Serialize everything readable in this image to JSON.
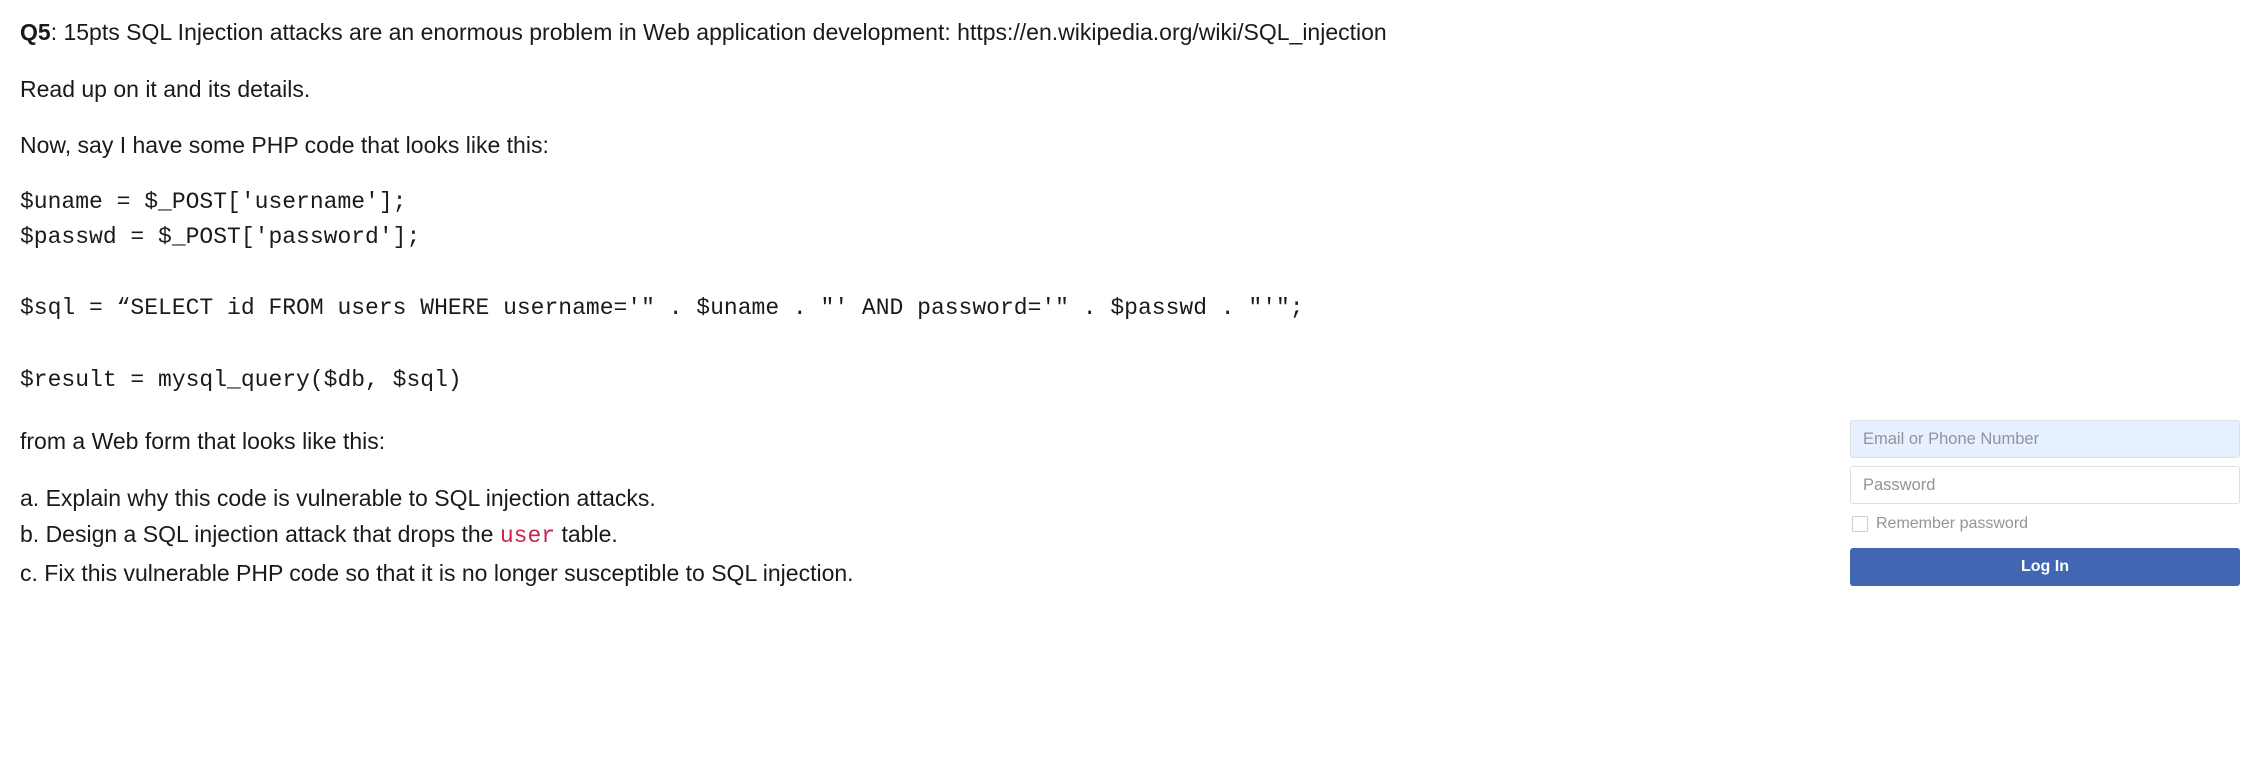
{
  "question": {
    "label": "Q5",
    "points_text": ": 15pts ",
    "intro_text": "SQL Injection attacks are an enormous problem in Web application development: https://en.wikipedia.org/wiki/SQL_injection",
    "read_up": "Read up on it and its details.",
    "php_intro": "Now, say I have some PHP code that looks like this:",
    "code": {
      "line1": "$uname = $_POST['username'];",
      "line2": "$passwd = $_POST['password'];",
      "line3": "$sql = “SELECT id FROM users WHERE username='\" . $uname . \"' AND password='\" . $passwd . \"'\";",
      "line4": "$result = mysql_query($db, $sql)"
    },
    "form_intro": "from a Web form that looks like this:",
    "parts": {
      "a": "a. Explain why this code is vulnerable to SQL injection attacks.",
      "b_prefix": "b. Design a SQL injection attack that drops the ",
      "b_code": "user",
      "b_suffix": " table.",
      "c": "c. Fix this vulnerable PHP code so that it is no longer susceptible to SQL injection."
    }
  },
  "login_form": {
    "email_placeholder": "Email or Phone Number",
    "password_placeholder": "Password",
    "remember_label": "Remember password",
    "button_label": "Log In"
  }
}
